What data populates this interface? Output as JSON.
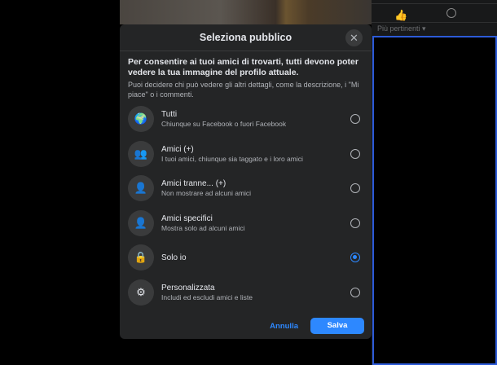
{
  "background": {
    "sort_label": "Più pertinenti ▾"
  },
  "dialog": {
    "title": "Seleziona pubblico",
    "intro_bold": "Per consentire ai tuoi amici di trovarti, tutti devono poter vedere la tua immagine del profilo attuale.",
    "intro_sub": "Puoi decidere chi può vedere gli altri dettagli, come la descrizione, i \"Mi piace\" o i commenti.",
    "options": [
      {
        "title": "Tutti",
        "desc": "Chiunque su Facebook o fuori Facebook",
        "icon": "globe-icon",
        "selected": false
      },
      {
        "title": "Amici (+)",
        "desc": "I tuoi amici, chiunque sia taggato e i loro amici",
        "icon": "friends-icon",
        "selected": false
      },
      {
        "title": "Amici tranne... (+)",
        "desc": "Non mostrare ad alcuni amici",
        "icon": "friends-except-icon",
        "selected": false
      },
      {
        "title": "Amici specifici",
        "desc": "Mostra solo ad alcuni amici",
        "icon": "person-icon",
        "selected": false
      },
      {
        "title": "Solo io",
        "desc": "",
        "icon": "lock-icon",
        "selected": true
      },
      {
        "title": "Personalizzata",
        "desc": "Includi ed escludi amici e liste",
        "icon": "gear-icon",
        "selected": false
      }
    ],
    "cancel_label": "Annulla",
    "save_label": "Salva"
  },
  "colors": {
    "accent": "#2d88ff",
    "dialog_bg": "#242526"
  }
}
